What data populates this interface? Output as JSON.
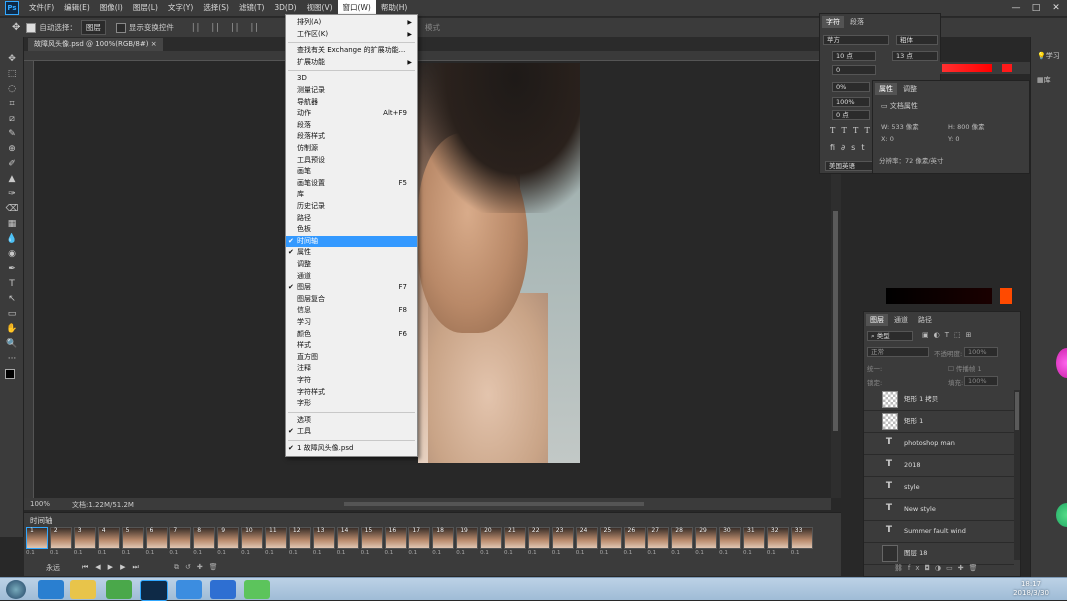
{
  "app": {
    "logo": "Ps"
  },
  "menubar": {
    "items": [
      "文件(F)",
      "编辑(E)",
      "图像(I)",
      "图层(L)",
      "文字(Y)",
      "选择(S)",
      "滤镜(T)",
      "3D(D)",
      "视图(V)",
      "窗口(W)",
      "帮助(H)"
    ],
    "active": "窗口(W)"
  },
  "options": {
    "auto_select_label": "自动选择：",
    "auto_select_value": "图层",
    "show_transform_label": "显示变换控件",
    "mode_label": "模式"
  },
  "document": {
    "tab_label": "故障风头像.psd @ 100%(RGB/8#)",
    "close": "×",
    "zoom": "100%",
    "doc_info": "文档:1.22M/51.2M"
  },
  "window_menu": {
    "items": [
      {
        "label": "排列(A)",
        "submenu": true
      },
      {
        "label": "工作区(K)",
        "submenu": true
      },
      {
        "sep": true
      },
      {
        "label": "查找有关 Exchange 的扩展功能..."
      },
      {
        "label": "扩展功能",
        "submenu": true
      },
      {
        "sep": true
      },
      {
        "label": "3D"
      },
      {
        "label": "测量记录"
      },
      {
        "label": "导航器"
      },
      {
        "label": "动作",
        "shortcut": "Alt+F9"
      },
      {
        "label": "段落"
      },
      {
        "label": "段落样式"
      },
      {
        "label": "仿制源"
      },
      {
        "label": "工具预设"
      },
      {
        "label": "画笔"
      },
      {
        "label": "画笔设置",
        "shortcut": "F5"
      },
      {
        "label": "库"
      },
      {
        "label": "历史记录"
      },
      {
        "label": "路径"
      },
      {
        "label": "色板"
      },
      {
        "label": "时间轴",
        "checked": true,
        "highlighted": true
      },
      {
        "label": "属性",
        "checked": true
      },
      {
        "label": "调整"
      },
      {
        "label": "通道"
      },
      {
        "label": "图层",
        "checked": true,
        "shortcut": "F7"
      },
      {
        "label": "图层复合"
      },
      {
        "label": "信息",
        "shortcut": "F8"
      },
      {
        "label": "学习"
      },
      {
        "label": "颜色",
        "shortcut": "F6"
      },
      {
        "label": "样式"
      },
      {
        "label": "直方图"
      },
      {
        "label": "注释"
      },
      {
        "label": "字符"
      },
      {
        "label": "字符样式"
      },
      {
        "label": "字形"
      },
      {
        "sep": true
      },
      {
        "label": "选项"
      },
      {
        "label": "工具",
        "checked": true
      },
      {
        "sep": true
      },
      {
        "label": "1 故障风头像.psd",
        "checked": true
      }
    ]
  },
  "character_panel": {
    "tabs": [
      "字符",
      "段落"
    ],
    "font": "苹方",
    "weight": "粗体",
    "size": "10 点",
    "leading": "13 点",
    "va": "0",
    "tracking": "0%",
    "scale_v": "100%",
    "baseline": "0 点",
    "language": "美国英语"
  },
  "properties_panel": {
    "tabs": [
      "属性",
      "调整"
    ],
    "title": "文档属性",
    "w_label": "W:",
    "w_value": "533 像素",
    "h_label": "H:",
    "h_value": "800 像素",
    "x_label": "X:",
    "x_value": "0",
    "y_label": "Y:",
    "y_value": "0",
    "resolution": "分辨率：72 像素/英寸"
  },
  "right_column": {
    "learn": "学习",
    "library": "库"
  },
  "layers_panel": {
    "tabs": [
      "图层",
      "通道",
      "路径"
    ],
    "filter": "类型",
    "blend": "正常",
    "opacity_label": "不透明度:",
    "opacity": "100%",
    "fill_label": "填充:",
    "fill": "100%",
    "propagate": "传播帧 1",
    "unify": "统一:",
    "lock": "锁定:",
    "layers": [
      {
        "name": "矩形 1 拷贝",
        "kind": "shape"
      },
      {
        "name": "矩形 1",
        "kind": "shape"
      },
      {
        "name": "photoshop man",
        "kind": "text"
      },
      {
        "name": "2018",
        "kind": "text"
      },
      {
        "name": "style",
        "kind": "text"
      },
      {
        "name": "New style",
        "kind": "text"
      },
      {
        "name": "Summer  fault wind",
        "kind": "text"
      },
      {
        "name": "图层 18",
        "kind": "group"
      }
    ]
  },
  "timeline": {
    "title": "时间轴",
    "loop": "永远",
    "frames": [
      "1",
      "2",
      "3",
      "4",
      "5",
      "6",
      "7",
      "8",
      "9",
      "10",
      "11",
      "12",
      "13",
      "14",
      "15",
      "16",
      "17",
      "18",
      "19",
      "20",
      "21",
      "22",
      "23",
      "24",
      "25",
      "26",
      "27",
      "28",
      "29",
      "30",
      "31",
      "32",
      "33"
    ],
    "delay": "0.1"
  },
  "taskbar": {
    "time": "18:17",
    "date": "2018/3/30"
  },
  "colors": {
    "accent": "#31a8ff",
    "menu_highlight": "#3399ff",
    "panel": "#3b3b3b",
    "canvas": "#282828"
  }
}
